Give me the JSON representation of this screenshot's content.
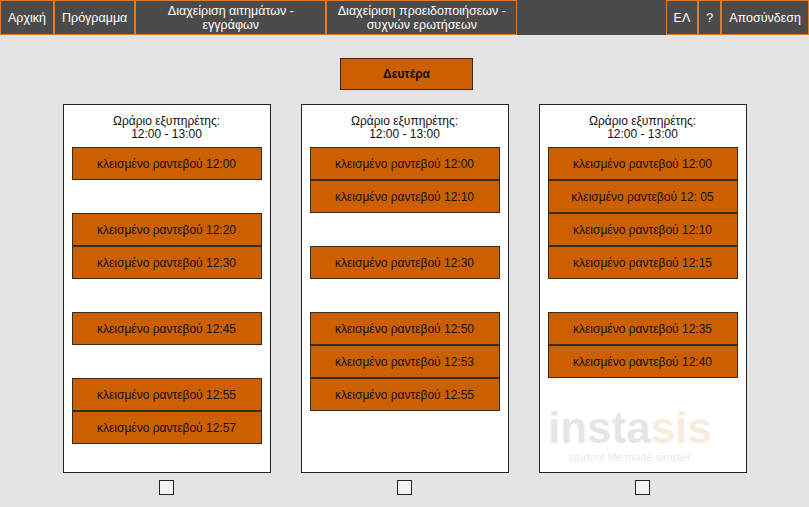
{
  "nav": {
    "items": [
      {
        "label": "Αρχική",
        "selected": false
      },
      {
        "label": "Πρόγραμμα",
        "selected": false
      },
      {
        "label": "Διαχείριση αιτημάτων - εγγράφων",
        "selected": false
      },
      {
        "label": "Διαχείριση προειδοποιήσεων - συχνών ερωτήσεων",
        "selected": false
      }
    ],
    "right_items": [
      {
        "label": "ΕΛ"
      },
      {
        "label": "?"
      },
      {
        "label": "Αποσύνδεση"
      }
    ]
  },
  "day": {
    "label": "Δευτέρα"
  },
  "columns": [
    {
      "header": "Ωράριο εξυπηρέτης:",
      "hours": "12:00 - 13:00",
      "checked": false,
      "slots": [
        {
          "kind": "booked",
          "label": "κλεισμένο ραντεβού 12:00"
        },
        {
          "kind": "free"
        },
        {
          "kind": "booked",
          "label": "κλεισμένο ραντεβού 12:20"
        },
        {
          "kind": "booked",
          "label": "κλεισμένο ραντεβού 12:30"
        },
        {
          "kind": "free"
        },
        {
          "kind": "booked",
          "label": "κλεισμένο ραντεβού 12:45"
        },
        {
          "kind": "free"
        },
        {
          "kind": "booked",
          "label": "κλεισμένο ραντεβού 12:55"
        },
        {
          "kind": "booked",
          "label": "κλεισμένο ραντεβού 12:57"
        }
      ]
    },
    {
      "header": "Ωράριο εξυπηρέτης:",
      "hours": "12:00 - 13:00",
      "checked": false,
      "slots": [
        {
          "kind": "booked",
          "label": "κλεισμένο ραντεβού 12:00"
        },
        {
          "kind": "booked",
          "label": "κλεισμένο ραντεβού 12:10"
        },
        {
          "kind": "free"
        },
        {
          "kind": "booked",
          "label": "κλεισμένο ραντεβού 12:30"
        },
        {
          "kind": "free"
        },
        {
          "kind": "booked",
          "label": "κλεισμένο ραντεβού 12:50"
        },
        {
          "kind": "booked",
          "label": "κλεισμένο ραντεβού 12:53"
        },
        {
          "kind": "booked",
          "label": "κλεισμένο ραντεβού 12:55"
        }
      ]
    },
    {
      "header": "Ωράριο εξυπηρέτης:",
      "hours": "12:00 - 13:00",
      "checked": false,
      "slots": [
        {
          "kind": "booked",
          "label": "κλεισμένο ραντεβού 12:00"
        },
        {
          "kind": "booked",
          "label": "κλεισμένο ραντεβού 12: 05"
        },
        {
          "kind": "booked",
          "label": "κλεισμένο ραντεβού 12:10"
        },
        {
          "kind": "booked",
          "label": "κλεισμένο ραντεβού 12:15"
        },
        {
          "kind": "free"
        },
        {
          "kind": "booked",
          "label": "κλεισμένο ραντεβού 12:35"
        },
        {
          "kind": "booked",
          "label": "κλεισμένο ραντεβού 12:40"
        }
      ]
    }
  ],
  "watermark": {
    "brand": "insta",
    "brand_accent": "sis",
    "tagline": "student life made simpler"
  }
}
